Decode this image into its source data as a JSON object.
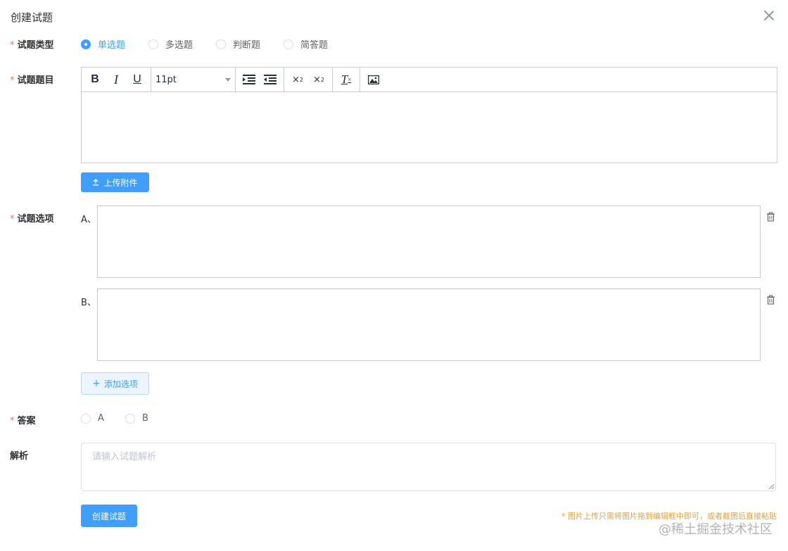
{
  "dialog": {
    "title": "创建试题"
  },
  "form": {
    "type_label": "试题类型",
    "required_mark": "*",
    "question_types": [
      {
        "label": "单选题",
        "checked": true
      },
      {
        "label": "多选题",
        "checked": false
      },
      {
        "label": "判断题",
        "checked": false
      },
      {
        "label": "简答题",
        "checked": false
      }
    ],
    "stem_label": "试题题目",
    "editor": {
      "font_size": "11pt",
      "tools": [
        "bold-icon",
        "italic-icon",
        "underline-icon",
        "indent-icon",
        "outdent-icon",
        "superscript-icon",
        "subscript-icon",
        "clear-format-icon",
        "image-icon"
      ]
    },
    "upload_label": "上传附件",
    "options_label": "试题选项",
    "options": [
      {
        "letter": "A、"
      },
      {
        "letter": "B、"
      }
    ],
    "add_option_label": "添加选项",
    "answer_label": "答案",
    "answers": [
      {
        "label": "A",
        "checked": false
      },
      {
        "label": "B",
        "checked": false
      }
    ],
    "analysis_label": "解析",
    "analysis_placeholder": "请输入试题解析",
    "submit_label": "创建试题",
    "hint": "* 图片上传只需将图片拖到编辑框中即可，或者截图后直接粘贴"
  },
  "watermark": "@稀土掘金技术社区",
  "colors": {
    "primary": "#409eff",
    "required": "#f56c6c",
    "hint": "#e6a23c"
  }
}
